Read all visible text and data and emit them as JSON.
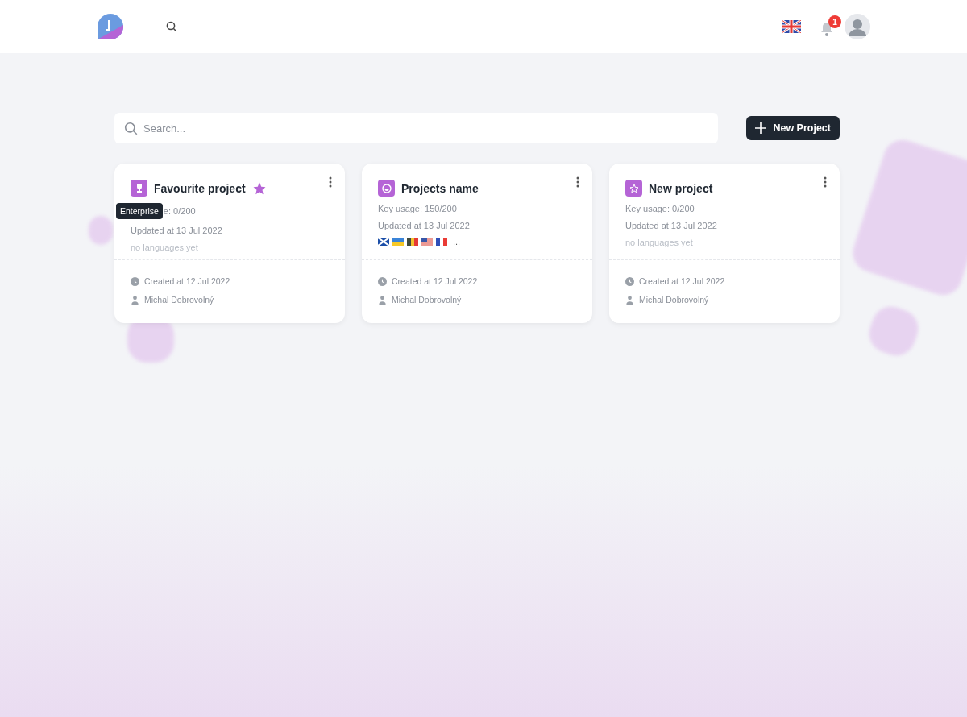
{
  "header": {
    "notifications": "1"
  },
  "search": {
    "placeholder": "Search..."
  },
  "new_project_button": {
    "label": "New Project"
  },
  "projects": [
    {
      "name": "Favourite project",
      "kind": "trophy",
      "favourite": true,
      "tooltip": "Enterprise",
      "key_usage": "e: 0/200",
      "updated": "Updated at 13 Jul 2022",
      "languages_empty": "no languages yet",
      "created": "Created at 12 Jul 2022",
      "author": "Michal Dobrovolný"
    },
    {
      "name": "Projects name",
      "kind": "face",
      "favourite": false,
      "key_usage": "Key usage: 150/200",
      "updated": "Updated at 13 Jul 2022",
      "flags": [
        {
          "kind": "scotland"
        },
        {
          "kind": "ukraine"
        },
        {
          "kind": "belgium"
        },
        {
          "kind": "usa"
        },
        {
          "kind": "france"
        }
      ],
      "more_flags": "...",
      "created": "Created at 12 Jul 2022",
      "author": "Michal Dobrovolný"
    },
    {
      "name": "New project",
      "kind": "star",
      "favourite": false,
      "key_usage": "Key usage: 0/200",
      "updated": "Updated at 13 Jul 2022",
      "languages_empty": "no languages yet",
      "created": "Created at 12 Jul 2022",
      "author": "Michal Dobrovolný"
    }
  ]
}
